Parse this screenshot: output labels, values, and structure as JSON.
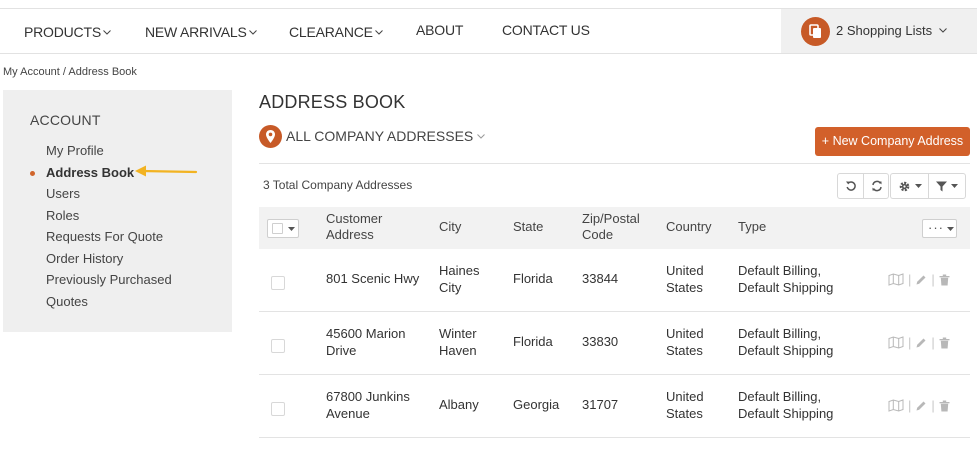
{
  "nav": {
    "items": [
      {
        "label": "PRODUCTS",
        "dropdown": true
      },
      {
        "label": "NEW ARRIVALS",
        "dropdown": true
      },
      {
        "label": "CLEARANCE",
        "dropdown": true
      },
      {
        "label": "ABOUT",
        "dropdown": false
      },
      {
        "label": "CONTACT US",
        "dropdown": false
      }
    ],
    "shopping_lists": "2 Shopping Lists",
    "chevron": "⌄"
  },
  "breadcrumb": "My Account / Address Book",
  "sidebar": {
    "title": "ACCOUNT",
    "items": [
      {
        "label": "My Profile"
      },
      {
        "label": "Address Book"
      },
      {
        "label": "Users"
      },
      {
        "label": "Roles"
      },
      {
        "label": "Requests For Quote"
      },
      {
        "label": "Order History"
      },
      {
        "label": "Previously Purchased"
      },
      {
        "label": "Quotes"
      }
    ],
    "active_index": 1
  },
  "main": {
    "title": "ADDRESS BOOK",
    "filter_label": "ALL COMPANY ADDRESSES",
    "new_button": "+ New Company Address",
    "total": "3 Total Company Addresses",
    "columns": [
      "Customer Address",
      "City",
      "State",
      "Zip/Postal Code",
      "Country",
      "Type"
    ],
    "rows": [
      {
        "address": "801 Scenic Hwy",
        "city": "Haines City",
        "state": "Florida",
        "zip": "33844",
        "country": "United States",
        "type": "Default Billing, Default Shipping"
      },
      {
        "address": "45600 Marion Drive",
        "city": "Winter Haven",
        "state": "Florida",
        "zip": "33830",
        "country": "United States",
        "type": "Default Billing, Default Shipping"
      },
      {
        "address": "67800 Junkins Avenue",
        "city": "Albany",
        "state": "Georgia",
        "zip": "31707",
        "country": "United States",
        "type": "Default Billing, Default Shipping"
      }
    ],
    "more_label": "···"
  },
  "colors": {
    "accent": "#d2602a",
    "icon_circle": "#c75a27",
    "sidebar_bg": "#efefef",
    "arrow": "#f2b322"
  },
  "icons": {
    "shopping_lists": "clipboard-icon",
    "filter": "map-pin-icon",
    "toolbar": [
      "reset-icon",
      "refresh-icon",
      "gear-icon",
      "filter-icon"
    ],
    "row_actions": [
      "map-icon",
      "pencil-icon",
      "trash-icon"
    ]
  }
}
